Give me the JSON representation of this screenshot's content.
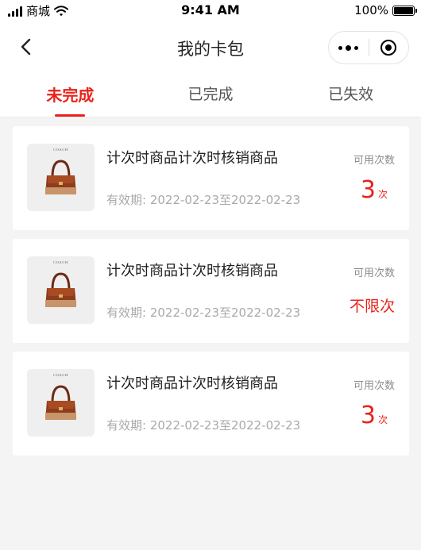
{
  "status_bar": {
    "carrier": "商城",
    "time": "9:41 AM",
    "battery": "100%"
  },
  "nav": {
    "title": "我的卡包"
  },
  "tabs": [
    {
      "label": "未完成",
      "active": true
    },
    {
      "label": "已完成",
      "active": false
    },
    {
      "label": "已失效",
      "active": false
    }
  ],
  "cards": [
    {
      "title": "计次时商品计次时核销商品",
      "validity": "有效期: 2022-02-23至2022-02-23",
      "count_label": "可用次数",
      "count_number": "3",
      "count_unit": "次"
    },
    {
      "title": "计次时商品计次时核销商品",
      "validity": "有效期: 2022-02-23至2022-02-23",
      "count_label": "可用次数",
      "count_text": "不限次"
    },
    {
      "title": "计次时商品计次时核销商品",
      "validity": "有效期: 2022-02-23至2022-02-23",
      "count_label": "可用次数",
      "count_number": "3",
      "count_unit": "次"
    }
  ],
  "product_image": {
    "brand_mark": "COACH"
  },
  "colors": {
    "accent": "#e8231b",
    "background": "#f4f4f4",
    "card": "#ffffff"
  },
  "icons": {
    "back": "chevron-left-icon",
    "more": "more-dots-icon",
    "close": "close-circle-icon",
    "signal": "signal-icon",
    "wifi": "wifi-icon",
    "battery": "battery-icon"
  }
}
